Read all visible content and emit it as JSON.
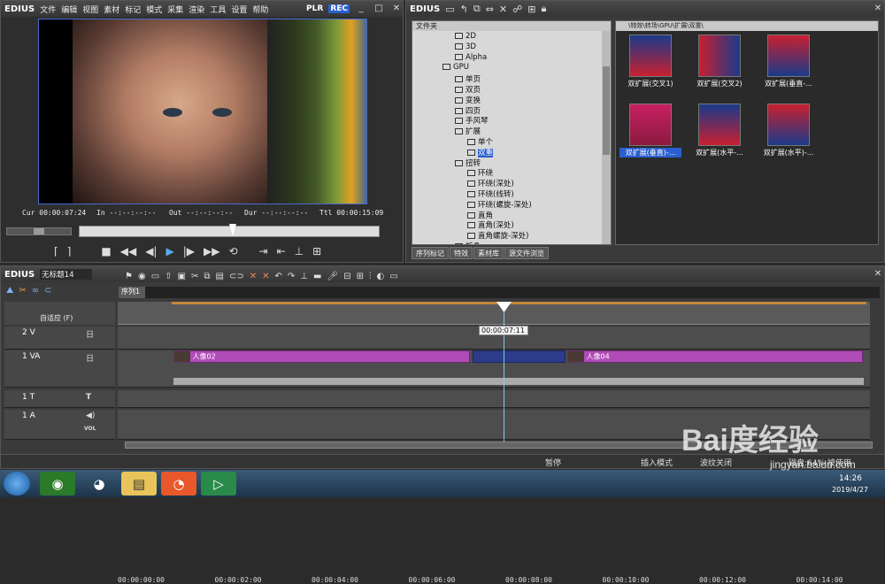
{
  "player": {
    "logo": "EDIUS",
    "menus": [
      "文件",
      "编辑",
      "视图",
      "素材",
      "标记",
      "模式",
      "采集",
      "渲染",
      "工具",
      "设置",
      "帮助"
    ],
    "plr": "PLR",
    "rec": "REC",
    "cur": "Cur 00:00:07:24",
    "in": "In --:--:--:--",
    "out": "Out --:--:--:--",
    "dur": "Dur --:--:--:--",
    "ttl": "Ttl 00:00:15:09"
  },
  "effects": {
    "logo": "EDIUS",
    "folder_header": "文件夹",
    "path": "\\特效\\转场\\GPU\\扩展\\双重\\",
    "tree": [
      {
        "label": "2D",
        "level": 2,
        "sel": false
      },
      {
        "label": "3D",
        "level": 2,
        "sel": false
      },
      {
        "label": "Alpha",
        "level": 2,
        "sel": false
      },
      {
        "label": "GPU",
        "level": 1,
        "sel": false
      },
      {
        "label": "单页",
        "level": 2,
        "sel": false
      },
      {
        "label": "双页",
        "level": 2,
        "sel": false
      },
      {
        "label": "变换",
        "level": 2,
        "sel": false
      },
      {
        "label": "四页",
        "level": 2,
        "sel": false
      },
      {
        "label": "手风琴",
        "level": 2,
        "sel": false
      },
      {
        "label": "扩展",
        "level": 2,
        "sel": false
      },
      {
        "label": "单个",
        "level": 3,
        "sel": false
      },
      {
        "label": "双重",
        "level": 3,
        "sel": true
      },
      {
        "label": "扭转",
        "level": 2,
        "sel": false
      },
      {
        "label": "环绕",
        "level": 3,
        "sel": false
      },
      {
        "label": "环绕(深处)",
        "level": 3,
        "sel": false
      },
      {
        "label": "环绕(线转)",
        "level": 3,
        "sel": false
      },
      {
        "label": "环绕(螺旋-深处)",
        "level": 3,
        "sel": false
      },
      {
        "label": "直角",
        "level": 3,
        "sel": false
      },
      {
        "label": "直角(深处)",
        "level": 3,
        "sel": false
      },
      {
        "label": "直角螺旋-深处)",
        "level": 3,
        "sel": false
      },
      {
        "label": "折叠",
        "level": 2,
        "sel": false
      }
    ],
    "thumbs": [
      {
        "label": "双扩展(交叉1)",
        "sel": false
      },
      {
        "label": "双扩展(交叉2)",
        "sel": false
      },
      {
        "label": "双扩展(垂直-...",
        "sel": false
      },
      {
        "label": "双扩展(垂直)-...",
        "sel": true
      },
      {
        "label": "双扩展(水平-...",
        "sel": false
      },
      {
        "label": "双扩展(水平)-...",
        "sel": false
      }
    ],
    "tabs": [
      "序列标记",
      "特效",
      "素材库",
      "源文件浏览"
    ]
  },
  "timeline": {
    "logo": "EDIUS",
    "project": "无标题14",
    "seq_tab": "序列1",
    "mode": "自适应 (F)",
    "ruler": [
      "00:00:00:00",
      "00:00:02:00",
      "00:00:04:00",
      "00:00:06:00",
      "00:00:08:00",
      "00:00:10:00",
      "00:00:12:00",
      "00:00:14:00"
    ],
    "tooltip": "00:00:07:11",
    "tracks": [
      {
        "name": "2 V",
        "icon": "日"
      },
      {
        "name": "1 VA",
        "icon": "日"
      },
      {
        "name": "1 T",
        "icon": "T"
      },
      {
        "name": "1 A",
        "icon": "◀)",
        "vol": "VOL"
      }
    ],
    "clip1": "人像02",
    "clip2": "人像04",
    "status": {
      "pause": "暂停",
      "mode": "插入模式",
      "ripple": "波纹关闭",
      "disk": "磁盘:64% 被使用"
    }
  },
  "taskbar": {
    "time": "14:26",
    "date": "2019/4/27"
  },
  "watermark": {
    "brand": "Bai度经验",
    "url": "jingyan.baidu.com"
  }
}
